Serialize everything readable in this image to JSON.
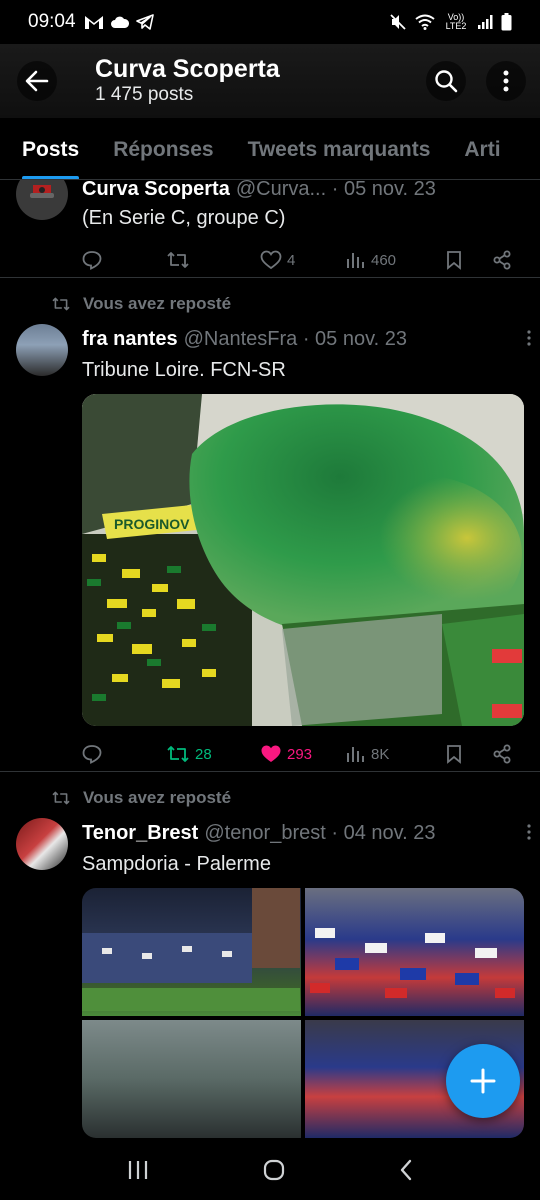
{
  "status_bar": {
    "time": "09:04",
    "left_icons": [
      "gmail-icon",
      "cloud-icon",
      "telegram-icon"
    ],
    "right_icons": [
      "mute-icon",
      "wifi-icon",
      "volte-icon",
      "signal-icon",
      "battery-icon"
    ],
    "network_label": "Vo)) LTE2"
  },
  "header": {
    "title": "Curva Scoperta",
    "post_count": "1 475 posts"
  },
  "tabs": [
    {
      "label": "Posts",
      "active": true
    },
    {
      "label": "Réponses",
      "active": false
    },
    {
      "label": "Tweets marquants",
      "active": false
    },
    {
      "label": "Arti",
      "active": false
    }
  ],
  "posts": [
    {
      "name": "Curva Scoperta",
      "handle": "@Curva...",
      "date": "05 nov. 23",
      "text": "(En Serie C, groupe C)",
      "replies": "",
      "reposts": "",
      "likes": "4",
      "views": "460"
    },
    {
      "repost_label": "Vous avez reposté",
      "name": "fra nantes",
      "handle": "@NantesFra",
      "date": "05 nov. 23",
      "text": "Tribune Loire. FCN-SR",
      "replies": "",
      "reposts": "28",
      "likes": "293",
      "views": "8K",
      "image_banner_text": "PROGINOV"
    },
    {
      "repost_label": "Vous avez reposté",
      "name": "Tenor_Brest",
      "handle": "@tenor_brest",
      "date": "04 nov. 23",
      "text": "Sampdoria - Palerme"
    }
  ],
  "colors": {
    "accent": "#1d9bf0",
    "repost_active": "#00ba7c",
    "like_active": "#f91880",
    "muted": "#71767b"
  }
}
